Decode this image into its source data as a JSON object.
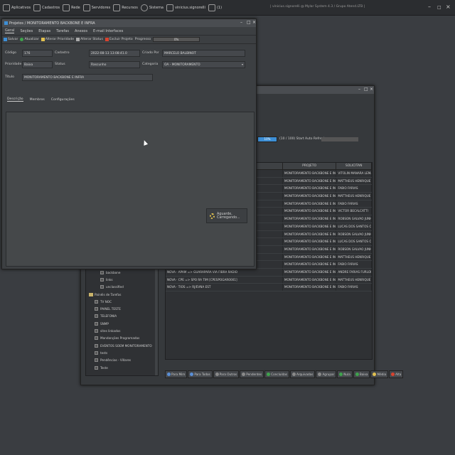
{
  "taskbar": {
    "items": [
      {
        "label": "Aplicativos",
        "icon": "apps-icon"
      },
      {
        "label": "Cadastros",
        "icon": "grid-icon"
      },
      {
        "label": "Rede",
        "icon": "network-icon"
      },
      {
        "label": "Servidores",
        "icon": "server-icon"
      },
      {
        "label": "Recursos",
        "icon": "resources-icon"
      },
      {
        "label": "Sistema",
        "icon": "gear-icon"
      },
      {
        "label": "vinicius.signorelli",
        "icon": "user-icon"
      },
      {
        "label": "(1)",
        "icon": "bell-icon"
      }
    ],
    "title": "| vinicius.signorelli @ Mylar System 4.3 / Grupo Atend.LTB |",
    "controls": [
      "–",
      "□",
      "×"
    ]
  },
  "back_window": {
    "controls": [
      "–",
      "□",
      "×"
    ],
    "progress_value": "10%",
    "progress_text": "(10 / 100)   Start Auto Refresh",
    "table": {
      "headers": [
        "",
        "PROJETO",
        "SOLICITAN"
      ],
      "rows": [
        {
          "c1": "",
          "c2": "MONITORAMENTO BACKBONE E INFRA",
          "c3": "VITOLIN MANARA LEMANT"
        },
        {
          "c1": "",
          "c2": "MONITORAMENTO BACKBONE E INFRA",
          "c3": "MATTHEUS HENRIQUE OE"
        },
        {
          "c1": "",
          "c2": "MONITORAMENTO BACKBONE E INFRA",
          "c3": "FABIO FARIAS"
        },
        {
          "c1": "[ETA] TRABALHO",
          "c2": "MONITORAMENTO BACKBONE E INFRA",
          "c3": "MATTHEUS HENRIQUE OE"
        },
        {
          "c1": "",
          "c2": "MONITORAMENTO BACKBONE E INFRA",
          "c3": "FABIO FARIAS"
        },
        {
          "c1": "",
          "c2": "MONITORAMENTO BACKBONE E INFRA",
          "c3": "VICTOR BECALCATTI"
        },
        {
          "c1": "",
          "c2": "MONITORAMENTO BACKBONE E INFRA",
          "c3": "ROBSON GALVAO JUNIO"
        },
        {
          "c1": "",
          "c2": "MONITORAMENTO BACKBONE E INFRA",
          "c3": "LUCAS DOS SANTOS OLI"
        },
        {
          "c1": "",
          "c2": "MONITORAMENTO BACKBONE E INFRA",
          "c3": "ROBSON GALVAO JUNIO"
        },
        {
          "c1": "",
          "c2": "MONITORAMENTO BACKBONE E INFRA",
          "c3": "LUCAS DOS SANTOS OLI"
        },
        {
          "c1": "ENTA]",
          "c2": "MONITORAMENTO BACKBONE E INFRA",
          "c3": "ROBSON GALVAO JUNIO"
        },
        {
          "c1": "",
          "c2": "MONITORAMENTO BACKBONE E INFRA",
          "c3": "MATTHEUS HENRIQUE OE"
        },
        {
          "c1": "",
          "c2": "MONITORAMENTO BACKBONE E INFRA",
          "c3": "FABIO FARIAS"
        },
        {
          "c1": "NOVA  ·  APAM => GUARAPARA VIA FIBRA RADIO",
          "c2": "MONITORAMENTO BACKBONE E INFRA",
          "c3": "ANDRE FARIAS FURLON"
        },
        {
          "c1": "NOVA  ·  CPE => SPO RA TIM [CPESPOGAR0001]",
          "c2": "MONITORAMENTO BACKBONE E INFRA",
          "c3": "MATTHEUS HENRIQUE OE"
        },
        {
          "c1": "NOVA  ·  TIOS => RJ/EVNA EST",
          "c2": "MONITORAMENTO BACKBONE E INFRA",
          "c3": "FABIO FARIAS"
        }
      ]
    },
    "tree": [
      {
        "label": "backbone",
        "type": "item",
        "indent": 2
      },
      {
        "label": "links",
        "type": "item",
        "indent": 2
      },
      {
        "label": "unclassified",
        "type": "item",
        "indent": 2
      },
      {
        "label": "Painéis de Tarefas",
        "type": "folder",
        "indent": 0
      },
      {
        "label": "TV NOC",
        "type": "item",
        "indent": 1
      },
      {
        "label": "PAINEL TESTE",
        "type": "item",
        "indent": 1
      },
      {
        "label": "TELEFONIA",
        "type": "item",
        "indent": 1
      },
      {
        "label": "SNMP",
        "type": "item",
        "indent": 1
      },
      {
        "label": "sites linkados",
        "type": "item",
        "indent": 1
      },
      {
        "label": "Mandanções Programadas",
        "type": "item",
        "indent": 1
      },
      {
        "label": "EVENTOS SOEM MONITORAMENTO",
        "type": "item",
        "indent": 1
      },
      {
        "label": "tests",
        "type": "item",
        "indent": 1
      },
      {
        "label": "Pendências - Villares",
        "type": "item",
        "indent": 1
      },
      {
        "label": "Teste",
        "type": "item",
        "indent": 1
      }
    ],
    "bottom_buttons": [
      {
        "label": "Para Mim",
        "color": "#5a8fd6"
      },
      {
        "label": "Para Todos",
        "color": "#5a8fd6"
      },
      {
        "label": "Para Outros",
        "color": "#8a8a8a"
      },
      {
        "label": "Pendentes",
        "color": "#8a8a8a"
      },
      {
        "label": "Concluídas",
        "color": "#3fa34d"
      },
      {
        "label": "Arquivadas",
        "color": "#8a8a8a"
      },
      {
        "label": "Agrupar",
        "color": "#8a8a8a"
      },
      {
        "label": "Nula",
        "color": "#3fa34d"
      },
      {
        "label": "Baixa",
        "color": "#3fa34d"
      },
      {
        "label": "Média",
        "color": "#e0c050"
      },
      {
        "label": "Alta",
        "color": "#d9432f"
      }
    ]
  },
  "front_window": {
    "title": "Projetos / MONITORAMENTO BACKBONE E INFRA",
    "controls": [
      "–",
      "□",
      "×"
    ],
    "menu": [
      "Geral",
      "Seções",
      "Etapas",
      "Tarefas",
      "Anexos",
      "E-mail Interfaces"
    ],
    "toolbar": {
      "salvar": "Salvar",
      "atualizar": "Atualizar",
      "alterar_prioridade": "Alterar Prioridade",
      "alterar_status": "Alterar Status",
      "excluir_projeto": "Excluir Projeto",
      "progresso_label": "Progresso",
      "progress_value": "0%"
    },
    "form": {
      "codigo_label": "Código",
      "codigo": "176",
      "cadastro_label": "Cadastro",
      "cadastro": "2022-08-13 13:08:41.0",
      "criado_por_label": "Criado Por",
      "criado_por": "MARCELO BALBINOT",
      "prioridade_label": "Prioridade",
      "prioridade": "Baixa",
      "status_label": "Status",
      "status": "Rascunho",
      "categoria_label": "Categoria",
      "categoria": "OA - MONITORAMENTO",
      "titulo_label": "Título",
      "titulo": "MONITORAMENTO BACKBONE E INFRA"
    },
    "subtabs": [
      "Descrição",
      "Membros",
      "Configurações"
    ],
    "loading_text": "Aguarde, Carregando..."
  },
  "colors": {
    "save": "#3d8fd6",
    "refresh": "#3fa34d",
    "priority": "#e0c050",
    "delete": "#d9432f"
  }
}
